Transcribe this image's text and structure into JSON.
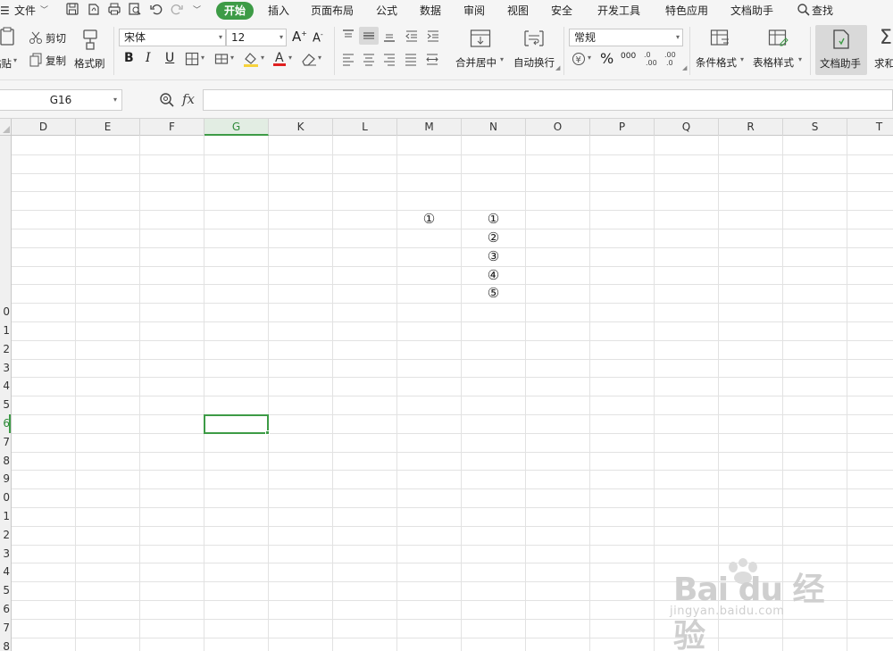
{
  "menubar": {
    "file_label": "文件",
    "tabs": [
      "开始",
      "插入",
      "页面布局",
      "公式",
      "数据",
      "审阅",
      "视图",
      "安全",
      "开发工具",
      "特色应用",
      "文档助手"
    ],
    "active_tab": "开始",
    "search_label": "查找"
  },
  "ribbon": {
    "paste_label": "粘贴",
    "cut_label": "剪切",
    "copy_label": "复制",
    "format_painter_label": "格式刷",
    "font_name": "宋体",
    "font_size": "12",
    "bold_label": "B",
    "italic_label": "I",
    "underline_label": "U",
    "merge_center_label": "合并居中",
    "wrap_text_label": "自动换行",
    "number_format": "常规",
    "percent_label": "%",
    "thousands_label": "000",
    "conditional_format_label": "条件格式",
    "table_style_label": "表格样式",
    "doc_assistant_label": "文档助手",
    "sum_label": "求和",
    "font_color": "#e02020",
    "fill_color": "#f7d23b"
  },
  "formula_bar": {
    "name_box": "G16",
    "formula_value": "",
    "fx_label": "fx"
  },
  "sheet": {
    "columns": [
      "D",
      "E",
      "F",
      "G",
      "K",
      "L",
      "M",
      "N",
      "O",
      "P",
      "Q",
      "R",
      "S",
      "T"
    ],
    "selected_column": "G",
    "row_labels": [
      "",
      "",
      "",
      "",
      "",
      "",
      "",
      "",
      "",
      "0",
      "1",
      "2",
      "3",
      "4",
      "5",
      "6",
      "7",
      "8",
      "9",
      "0",
      "1",
      "2",
      "3",
      "4",
      "5",
      "6",
      "7",
      "8"
    ],
    "selected_row_index": 15,
    "cells": {
      "M5": "①",
      "N5": "①",
      "N6": "②",
      "N7": "③",
      "N8": "④",
      "N9": "⑤"
    },
    "active_cell": "G16",
    "accent_color": "#3d9b46"
  },
  "watermark": {
    "logo_text": "Bai du 经验",
    "url_text": "jingyan.baidu.com"
  }
}
